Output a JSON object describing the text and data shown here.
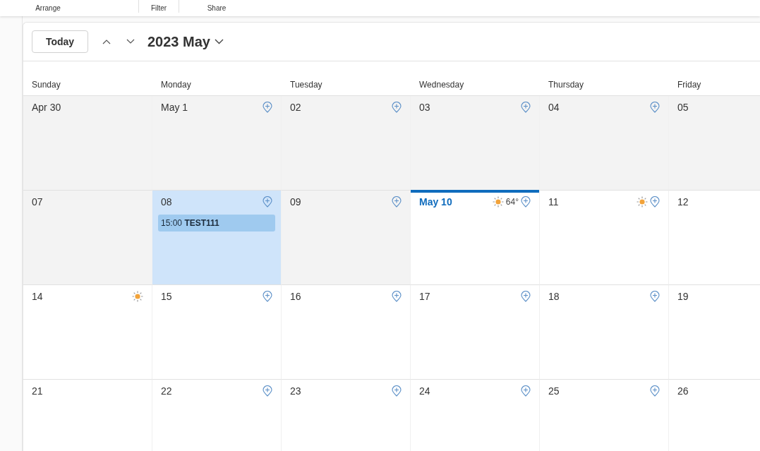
{
  "ribbon": {
    "groups": [
      {
        "label": "Arrange"
      },
      {
        "label": "Filter"
      },
      {
        "label": "Share"
      }
    ]
  },
  "toolbar": {
    "today_button": "Today",
    "title": "2023 May"
  },
  "weekdays": [
    "Sunday",
    "Monday",
    "Tuesday",
    "Wednesday",
    "Thursday",
    "Friday"
  ],
  "weeks": [
    [
      {
        "date": "Apr 30",
        "past": true,
        "selected": false
      },
      {
        "date": "May 1",
        "past": true,
        "selected": false,
        "add_icon": true
      },
      {
        "date": "02",
        "past": true,
        "selected": false,
        "add_icon": true
      },
      {
        "date": "03",
        "past": true,
        "selected": false,
        "add_icon": true
      },
      {
        "date": "04",
        "past": true,
        "selected": false,
        "add_icon": true
      },
      {
        "date": "05",
        "past": true,
        "selected": false
      }
    ],
    [
      {
        "date": "07",
        "past": true,
        "selected": false
      },
      {
        "date": "08",
        "selected": true,
        "add_icon": true,
        "events": [
          {
            "time": "15:00",
            "title": "TEST111"
          }
        ]
      },
      {
        "date": "09",
        "past": true,
        "selected": false,
        "add_icon": true
      },
      {
        "date": "May 10",
        "past": false,
        "selected": false,
        "today": true,
        "add_icon": true,
        "sun_icon": true,
        "temp": "64°"
      },
      {
        "date": "11",
        "past": false,
        "selected": false,
        "add_icon": true,
        "sun_icon": true
      },
      {
        "date": "12",
        "past": false,
        "selected": false
      }
    ],
    [
      {
        "date": "14",
        "past": false,
        "selected": false,
        "sun_icon": true
      },
      {
        "date": "15",
        "past": false,
        "selected": false,
        "add_icon": true
      },
      {
        "date": "16",
        "past": false,
        "selected": false,
        "add_icon": true
      },
      {
        "date": "17",
        "past": false,
        "selected": false,
        "add_icon": true
      },
      {
        "date": "18",
        "past": false,
        "selected": false,
        "add_icon": true
      },
      {
        "date": "19",
        "past": false,
        "selected": false
      }
    ],
    [
      {
        "date": "21",
        "past": false,
        "selected": false
      },
      {
        "date": "22",
        "past": false,
        "selected": false,
        "add_icon": true
      },
      {
        "date": "23",
        "past": false,
        "selected": false,
        "add_icon": true
      },
      {
        "date": "24",
        "past": false,
        "selected": false,
        "add_icon": true
      },
      {
        "date": "25",
        "past": false,
        "selected": false,
        "add_icon": true
      },
      {
        "date": "26",
        "past": false,
        "selected": false
      }
    ]
  ]
}
